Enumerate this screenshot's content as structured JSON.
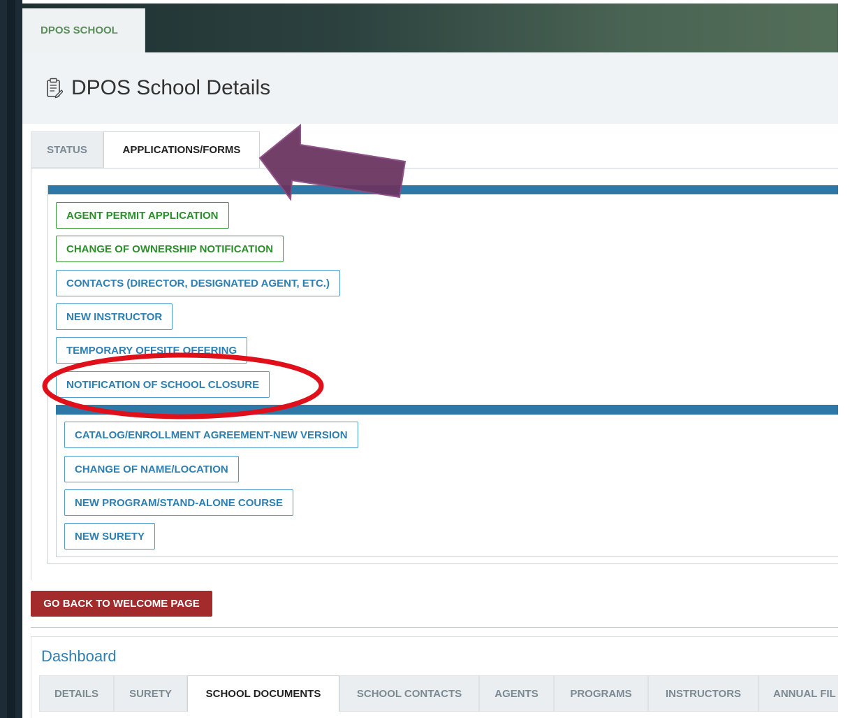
{
  "app": {
    "site_tab": "DPOS SCHOOL",
    "page_title": "DPOS School Details"
  },
  "tabs_top": [
    {
      "label": "STATUS",
      "active": false
    },
    {
      "label": "APPLICATIONS/FORMS",
      "active": true
    }
  ],
  "forms": {
    "group1": [
      {
        "label": "AGENT PERMIT APPLICATION",
        "style": "green"
      },
      {
        "label": "CHANGE OF OWNERSHIP NOTIFICATION",
        "style": "green"
      },
      {
        "label": "CONTACTS (DIRECTOR, DESIGNATED AGENT, ETC.)",
        "style": "blue"
      },
      {
        "label": "NEW INSTRUCTOR",
        "style": "blue"
      },
      {
        "label": "TEMPORARY OFFSITE OFFERING",
        "style": "blue"
      },
      {
        "label": "NOTIFICATION OF SCHOOL CLOSURE",
        "style": "blue"
      }
    ],
    "group2": [
      {
        "label": "CATALOG/ENROLLMENT AGREEMENT-NEW VERSION",
        "style": "blue"
      },
      {
        "label": "CHANGE OF NAME/LOCATION",
        "style": "blue"
      },
      {
        "label": "NEW PROGRAM/STAND-ALONE COURSE",
        "style": "blue"
      },
      {
        "label": "NEW SURETY",
        "style": "blue"
      }
    ]
  },
  "back_button": "GO BACK TO WELCOME PAGE",
  "dashboard": {
    "title": "Dashboard",
    "tabs": [
      {
        "label": "DETAILS",
        "active": false
      },
      {
        "label": "SURETY",
        "active": false
      },
      {
        "label": "SCHOOL DOCUMENTS",
        "active": true
      },
      {
        "label": "SCHOOL CONTACTS",
        "active": false
      },
      {
        "label": "AGENTS",
        "active": false
      },
      {
        "label": "PROGRAMS",
        "active": false
      },
      {
        "label": "INSTRUCTORS",
        "active": false
      },
      {
        "label": "ANNUAL FIL",
        "active": false
      }
    ]
  },
  "annotations": {
    "arrow_color": "#6b3560",
    "circle_color": "#e0101a"
  },
  "icons": {
    "page_icon": "clipboard-edit-icon"
  }
}
